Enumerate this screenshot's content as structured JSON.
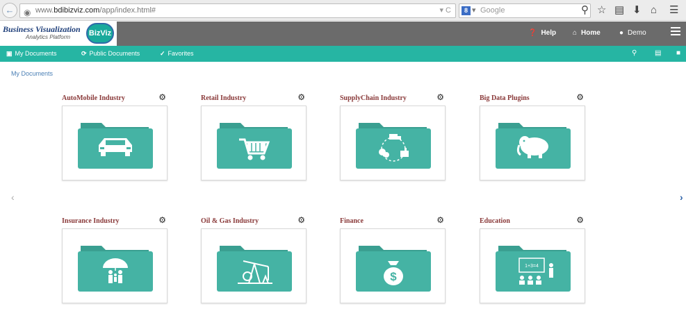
{
  "browser": {
    "url_prefix": "www.",
    "url_domain": "bdibizviz.com",
    "url_path": "/app/index.html#",
    "search_engine_badge": "8",
    "search_placeholder": "Google"
  },
  "header": {
    "brand_title": "Business Visualization",
    "brand_subtitle": "Analytics Platform",
    "brand_logo_text": "BizViz",
    "help_label": "Help",
    "home_label": "Home",
    "user_label": "Demo"
  },
  "nav": {
    "my_documents": "My Documents",
    "public_documents": "Public Documents",
    "favorites": "Favorites"
  },
  "breadcrumb": "My Documents",
  "folders": [
    {
      "title": "AutoMobile Industry",
      "icon": "car-icon"
    },
    {
      "title": "Retail Industry",
      "icon": "shopping-cart-icon"
    },
    {
      "title": "SupplyChain Industry",
      "icon": "supply-chain-icon"
    },
    {
      "title": "Big Data Plugins",
      "icon": "hadoop-elephant-icon"
    },
    {
      "title": "Insurance Industry",
      "icon": "umbrella-family-icon"
    },
    {
      "title": "Oil & Gas Industry",
      "icon": "oil-pump-icon"
    },
    {
      "title": "Finance",
      "icon": "money-bag-icon"
    },
    {
      "title": "Education",
      "icon": "classroom-icon"
    }
  ],
  "blackboard_text": "1+3=4",
  "money_symbol": "$",
  "colors": {
    "accent": "#26b5a3",
    "folder": "#45b3a4",
    "folder_tab": "#3a9f91",
    "header": "#6b6b6b",
    "card_title": "#8a3a3a"
  }
}
